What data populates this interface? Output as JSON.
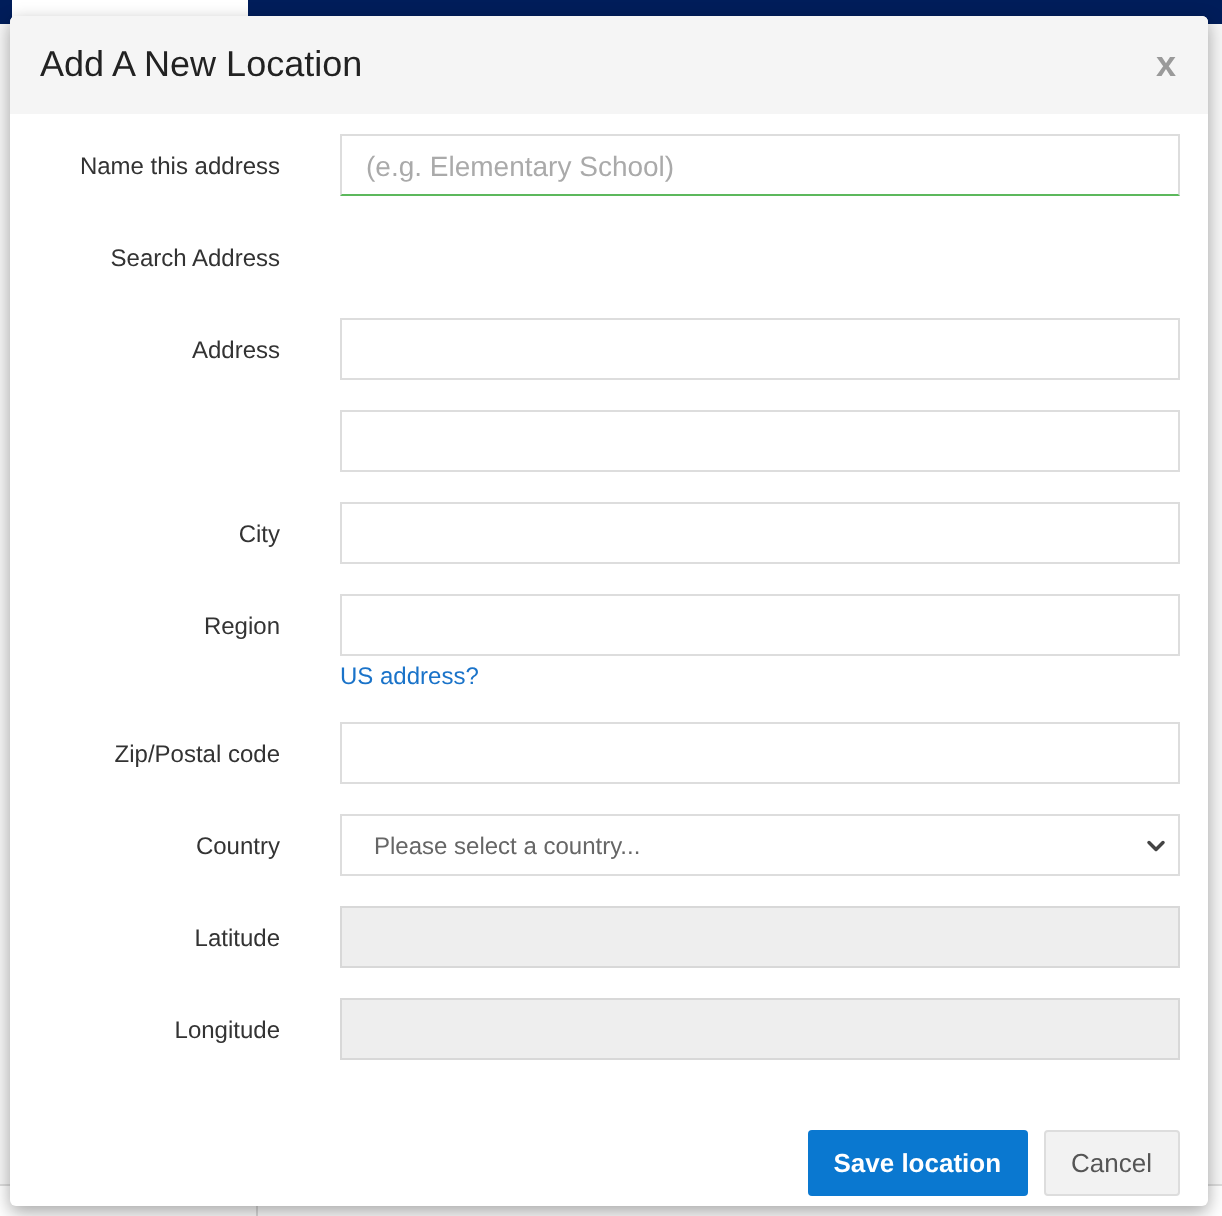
{
  "background": {
    "nav_tabs": [
      {
        "selected": true
      },
      {
        "selected": false
      },
      {
        "selected": false
      },
      {
        "selected": false
      }
    ]
  },
  "dialog": {
    "title": "Add A New Location",
    "close": "x",
    "fields": [
      {
        "kind": "text",
        "label": "Name this address",
        "placeholder": "(e.g. Elementary School)"
      },
      {
        "kind": "heading",
        "label": "Search Address"
      },
      {
        "kind": "text",
        "label": "Address"
      },
      {
        "kind": "text"
      },
      {
        "kind": "text",
        "label": "City"
      },
      {
        "kind": "text",
        "label": "Region",
        "link": "US address?"
      },
      {
        "kind": "text",
        "label": "Zip/Postal code"
      },
      {
        "kind": "select",
        "label": "Country",
        "value": "Please select a country..."
      },
      {
        "kind": "readonly",
        "label": "Latitude"
      },
      {
        "kind": "readonly",
        "label": "Longitude"
      }
    ],
    "buttons": [
      {
        "kind": "primary",
        "label": "Save location"
      },
      {
        "kind": "secondary",
        "label": "Cancel"
      }
    ]
  }
}
